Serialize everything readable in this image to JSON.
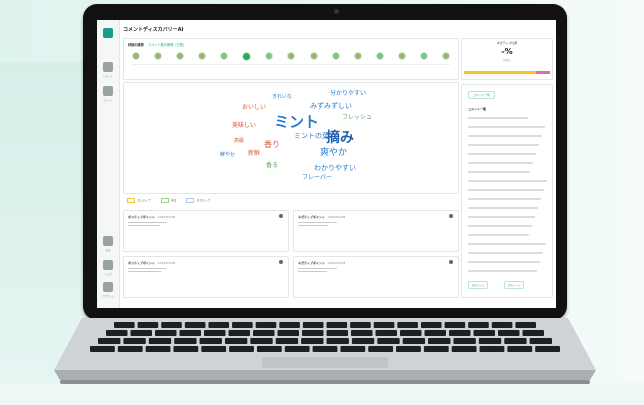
{
  "app": {
    "title": "コメントディスカバリーAI"
  },
  "sidebar": {
    "items": [
      {
        "icon": "home-icon",
        "label": ""
      },
      {
        "icon": "chart-icon",
        "label": "レポート"
      },
      {
        "icon": "list-icon",
        "label": "コメント"
      },
      {
        "icon": "settings-icon",
        "label": "設定"
      },
      {
        "icon": "help-icon",
        "label": "ヘルプ"
      },
      {
        "icon": "user-icon",
        "label": "アカウント"
      }
    ]
  },
  "timeline": {
    "title": "評価の推移",
    "subtitle": "コメント数の推移（日別）"
  },
  "wordcloud": {
    "words": [
      {
        "text": "ミント",
        "color": "#2a7bd0",
        "big": true
      },
      {
        "text": "摘み",
        "color": "#1f5fb0",
        "big": true
      },
      {
        "text": "爽やか",
        "color": "#2a7bd0",
        "big": false
      },
      {
        "text": "わかりやすい",
        "color": "#2a7bd0",
        "big": false
      },
      {
        "text": "みずみずしい",
        "color": "#2a7bd0",
        "big": false
      },
      {
        "text": "ミントの葉",
        "color": "#2a7bd0",
        "big": false
      },
      {
        "text": "おいしい",
        "color": "#d95b3a",
        "big": false
      },
      {
        "text": "香り",
        "color": "#d95b3a",
        "big": false
      },
      {
        "text": "新鮮",
        "color": "#d95b3a",
        "big": false
      },
      {
        "text": "フレッシュ",
        "color": "#5aa354",
        "big": false
      },
      {
        "text": "フレーバー",
        "color": "#2a7bd0",
        "big": false
      },
      {
        "text": "美味しい",
        "color": "#d95b3a",
        "big": false
      },
      {
        "text": "香る",
        "color": "#5aa354",
        "big": false
      },
      {
        "text": "きれいな",
        "color": "#2a7bd0",
        "big": false
      },
      {
        "text": "分かりやすい",
        "color": "#2a7bd0",
        "big": false
      },
      {
        "text": "高級",
        "color": "#d95b3a",
        "big": false
      },
      {
        "text": "鮮やか",
        "color": "#2a7bd0",
        "big": false
      }
    ],
    "legend": [
      "ポジティブ",
      "中立",
      "ネガティブ"
    ]
  },
  "points": [
    {
      "title": "ポジティブポイント",
      "date": "2023/01/28"
    },
    {
      "title": "ネガティブポイント",
      "date": "2023/01/28"
    },
    {
      "title": "ポジティブポイント",
      "date": "2023/01/28"
    },
    {
      "title": "ネガティブポイント",
      "date": "2023/01/28"
    }
  ],
  "kpi": {
    "title": "ネガティブ比率",
    "value": "-%",
    "sub": "前回比"
  },
  "right_panel": {
    "chip": "コメント一覧",
    "list_title": "コメント一覧",
    "btn_left": "前のページ",
    "btn_right": "次のページ"
  },
  "colors": {
    "accent": "#1a9c8c",
    "positive": "#34a853",
    "bar": "#f3c623"
  }
}
